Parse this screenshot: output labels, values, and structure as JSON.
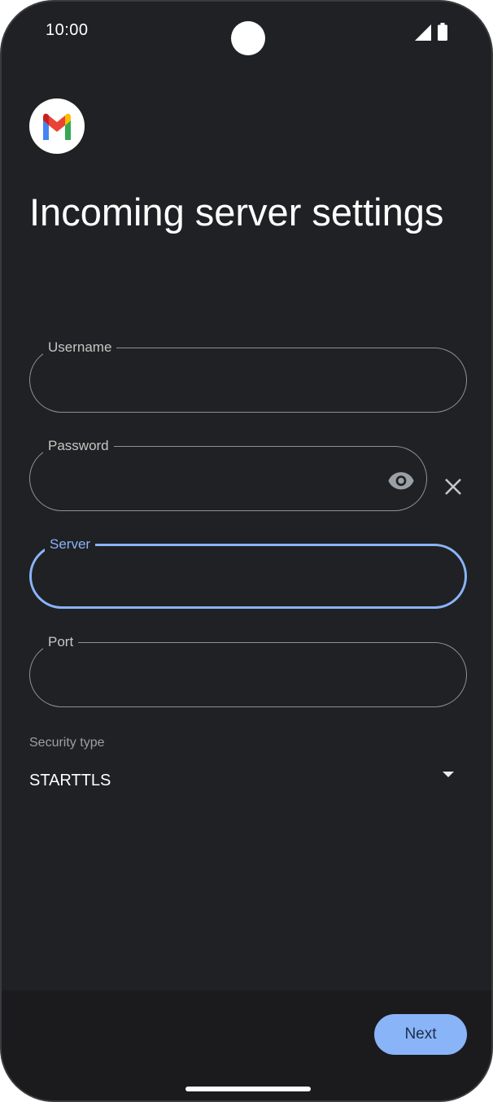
{
  "status_bar": {
    "time": "10:00",
    "signal_icon": "cellular-signal-icon",
    "battery_icon": "battery-full-icon"
  },
  "header": {
    "logo_icon": "gmail-logo-icon",
    "title": "Incoming server settings"
  },
  "form": {
    "username": {
      "label": "Username",
      "value": ""
    },
    "password": {
      "label": "Password",
      "value": "",
      "toggle_icon": "eye-icon",
      "clear_icon": "close-icon"
    },
    "server": {
      "label": "Server",
      "value": "",
      "focused": true
    },
    "port": {
      "label": "Port",
      "value": ""
    },
    "security_type": {
      "label": "Security type",
      "selected": "STARTTLS",
      "dropdown_icon": "dropdown-arrow-icon"
    }
  },
  "actions": {
    "next_label": "Next"
  },
  "colors": {
    "background": "#202124",
    "accent": "#8ab4f8",
    "outline": "#8e9196",
    "text": "#ffffff"
  }
}
